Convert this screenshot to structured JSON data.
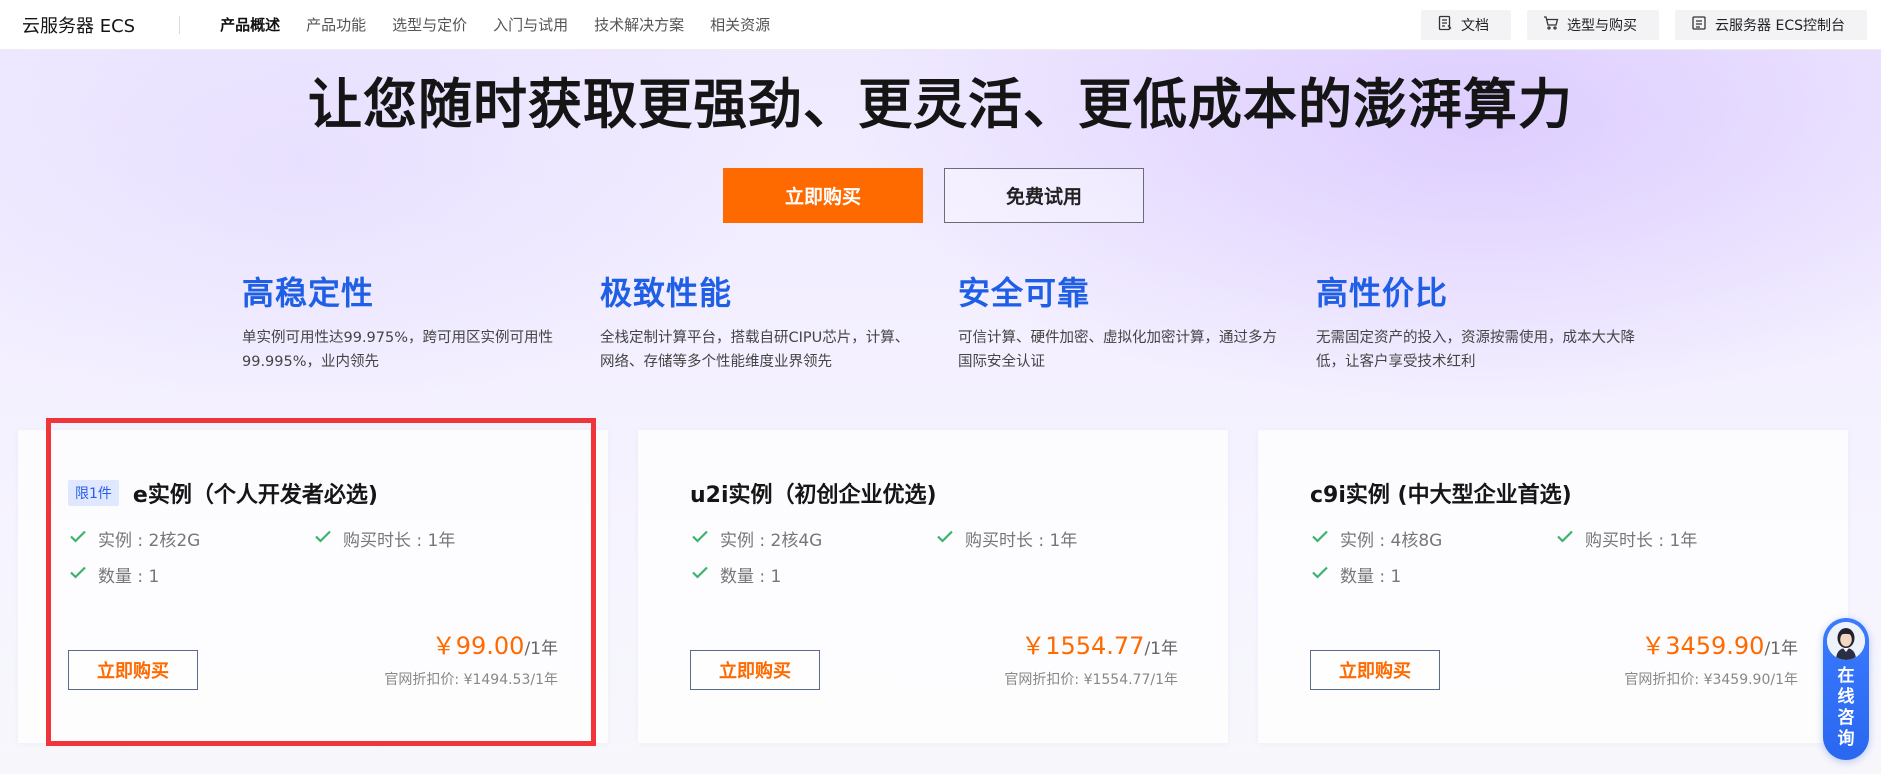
{
  "nav": {
    "brand": "云服务器 ECS",
    "links": [
      "产品概述",
      "产品功能",
      "选型与定价",
      "入门与试用",
      "技术解决方案",
      "相关资源"
    ],
    "right_buttons": [
      {
        "label": "文档",
        "icon": "document-icon"
      },
      {
        "label": "选型与购买",
        "icon": "cart-icon"
      },
      {
        "label": "云服务器 ECS控制台",
        "icon": "console-icon"
      }
    ]
  },
  "hero": {
    "title": "让您随时获取更强劲、更灵活、更低成本的澎湃算力",
    "buy_label": "立即购买",
    "trial_label": "免费试用"
  },
  "features": [
    {
      "title": "高稳定性",
      "desc": "单实例可用性达99.975%，跨可用区实例可用性99.995%，业内领先"
    },
    {
      "title": "极致性能",
      "desc": "全栈定制计算平台，搭载自研CIPU芯片，计算、网络、存储等多个性能维度业界领先"
    },
    {
      "title": "安全可靠",
      "desc": "可信计算、硬件加密、虚拟化加密计算，通过多方国际安全认证"
    },
    {
      "title": "高性价比",
      "desc": "无需固定资产的投入，资源按需使用，成本大大降低，让客户享受技术红利"
    }
  ],
  "cards": [
    {
      "badge": "限1件",
      "title": "e实例（个人开发者必选)",
      "spec_instance": "实例 : 2核2G",
      "spec_duration": "购买时长 : 1年",
      "spec_quantity": "数量 : 1",
      "price": "￥99.00",
      "price_unit": "/1年",
      "orig_price": "官网折扣价: ¥1494.53/1年",
      "buy_label": "立即购买"
    },
    {
      "badge": "",
      "title": "u2i实例（初创企业优选)",
      "spec_instance": "实例 : 2核4G",
      "spec_duration": "购买时长 : 1年",
      "spec_quantity": "数量 : 1",
      "price": "￥1554.77",
      "price_unit": "/1年",
      "orig_price": "官网折扣价: ¥1554.77/1年",
      "buy_label": "立即购买"
    },
    {
      "badge": "",
      "title": "c9i实例 (中大型企业首选)",
      "spec_instance": "实例 : 4核8G",
      "spec_duration": "购买时长 : 1年",
      "spec_quantity": "数量 : 1",
      "price": "￥3459.90",
      "price_unit": "/1年",
      "orig_price": "官网折扣价: ¥3459.90/1年",
      "buy_label": "立即购买"
    }
  ],
  "consult": {
    "label_line1": "在",
    "label_line2": "线",
    "label_line3": "咨",
    "label_line4": "询"
  },
  "colors": {
    "accent_orange": "#ff6a00",
    "feature_blue": "#1f5fe6",
    "highlight_red": "#f0353a",
    "check_green": "#3bb36b"
  }
}
